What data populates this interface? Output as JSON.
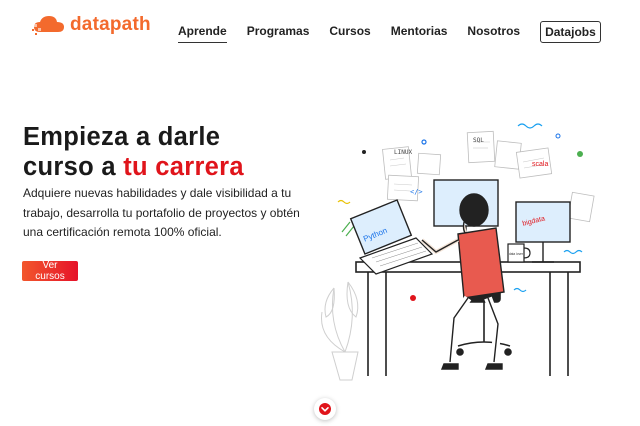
{
  "brand": {
    "name": "datapath",
    "accent": "#f36a2d"
  },
  "nav": {
    "items": [
      {
        "label": "Aprende",
        "active": true
      },
      {
        "label": "Programas"
      },
      {
        "label": "Cursos"
      },
      {
        "label": "Mentorias"
      },
      {
        "label": "Nosotros"
      }
    ],
    "cta_label": "Datajobs"
  },
  "hero": {
    "title_line1": "Empieza a darle",
    "title_line2_prefix": "curso a ",
    "title_line2_accent": "tu carrera",
    "accent_color": "#e0141b",
    "subtitle": "Adquiere nuevas habilidades y dale visibilidad a tu trabajo, desarrolla tu portafolio de proyectos y obtén una certificación remota 100% oficial.",
    "cta_label": "Ver cursos"
  },
  "illustration": {
    "labels": {
      "linux": "LINUX",
      "sql": "SQL",
      "scala": "scala",
      "python": "Python",
      "bigdata": "bigdata",
      "code": "</>",
      "mug": "data lover"
    }
  },
  "scroll": {
    "icon": "chevron-down-icon"
  }
}
